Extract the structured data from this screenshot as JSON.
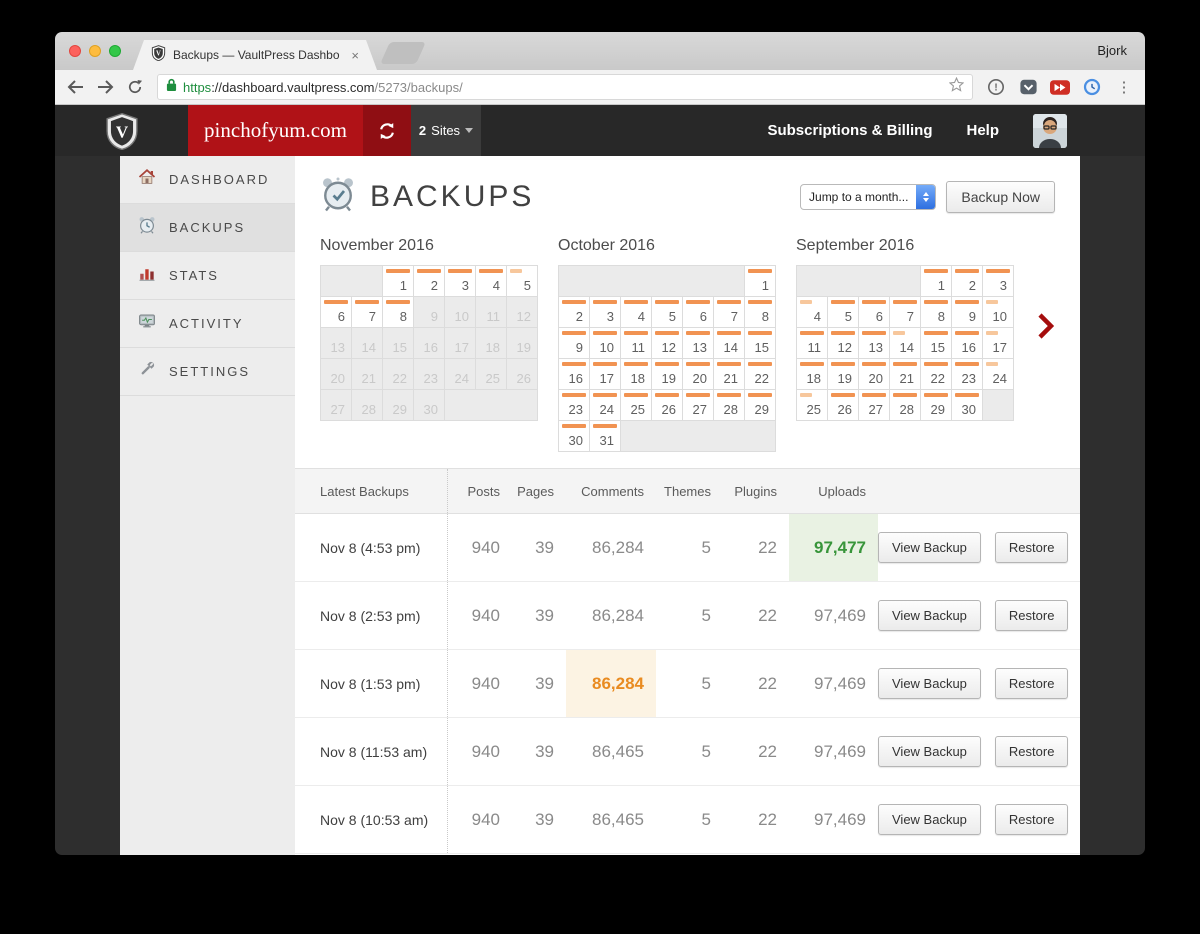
{
  "browser": {
    "tab_title": "Backups — VaultPress Dashbo",
    "profile": "Bjork",
    "url": {
      "scheme": "https",
      "host": "://dashboard.vaultpress.com",
      "path": "/5273/backups/"
    },
    "glyphs": {
      "tab_close": "×",
      "overflow_menu": "⋮"
    }
  },
  "nav": {
    "site_button": "pinchofyum.com",
    "sites_count": "2",
    "sites_label": "Sites",
    "billing_link": "Subscriptions & Billing",
    "help_link": "Help"
  },
  "sidebar": {
    "items": [
      {
        "label": "DASHBOARD",
        "icon": "house-icon",
        "active": false
      },
      {
        "label": "BACKUPS",
        "icon": "alarm-clock-icon",
        "active": true
      },
      {
        "label": "STATS",
        "icon": "bar-chart-icon",
        "active": false
      },
      {
        "label": "ACTIVITY",
        "icon": "activity-monitor-icon",
        "active": false
      },
      {
        "label": "SETTINGS",
        "icon": "wrench-icon",
        "active": false
      }
    ]
  },
  "main": {
    "title": "BACKUPS",
    "month_select": "Jump to a month...",
    "backup_now_button": "Backup Now"
  },
  "calendars": [
    {
      "title": "November 2016",
      "weeks": [
        [
          {
            "span": 2
          },
          {
            "d": 1,
            "bar": "normal"
          },
          {
            "d": 2,
            "bar": "normal"
          },
          {
            "d": 3,
            "bar": "normal"
          },
          {
            "d": 4,
            "bar": "normal"
          },
          {
            "d": 5,
            "bar": "light"
          }
        ],
        [
          {
            "d": 6,
            "bar": "normal"
          },
          {
            "d": 7,
            "bar": "normal"
          },
          {
            "d": 8,
            "bar": "normal"
          },
          {
            "d": 9,
            "off": true
          },
          {
            "d": 10,
            "off": true
          },
          {
            "d": 11,
            "off": true
          },
          {
            "d": 12,
            "off": true
          }
        ],
        [
          {
            "d": 13,
            "off": true
          },
          {
            "d": 14,
            "off": true
          },
          {
            "d": 15,
            "off": true
          },
          {
            "d": 16,
            "off": true
          },
          {
            "d": 17,
            "off": true
          },
          {
            "d": 18,
            "off": true
          },
          {
            "d": 19,
            "off": true
          }
        ],
        [
          {
            "d": 20,
            "off": true
          },
          {
            "d": 21,
            "off": true
          },
          {
            "d": 22,
            "off": true
          },
          {
            "d": 23,
            "off": true
          },
          {
            "d": 24,
            "off": true
          },
          {
            "d": 25,
            "off": true
          },
          {
            "d": 26,
            "off": true
          }
        ],
        [
          {
            "d": 27,
            "off": true
          },
          {
            "d": 28,
            "off": true
          },
          {
            "d": 29,
            "off": true
          },
          {
            "d": 30,
            "off": true
          },
          {
            "span": 3
          }
        ]
      ]
    },
    {
      "title": "October 2016",
      "weeks": [
        [
          {
            "span": 6
          },
          {
            "d": 1,
            "bar": "normal"
          }
        ],
        [
          {
            "d": 2,
            "bar": "normal"
          },
          {
            "d": 3,
            "bar": "normal"
          },
          {
            "d": 4,
            "bar": "normal"
          },
          {
            "d": 5,
            "bar": "normal"
          },
          {
            "d": 6,
            "bar": "normal"
          },
          {
            "d": 7,
            "bar": "normal"
          },
          {
            "d": 8,
            "bar": "normal"
          }
        ],
        [
          {
            "d": 9,
            "bar": "normal"
          },
          {
            "d": 10,
            "bar": "normal"
          },
          {
            "d": 11,
            "bar": "normal"
          },
          {
            "d": 12,
            "bar": "normal"
          },
          {
            "d": 13,
            "bar": "normal"
          },
          {
            "d": 14,
            "bar": "normal"
          },
          {
            "d": 15,
            "bar": "normal"
          }
        ],
        [
          {
            "d": 16,
            "bar": "normal"
          },
          {
            "d": 17,
            "bar": "normal"
          },
          {
            "d": 18,
            "bar": "normal"
          },
          {
            "d": 19,
            "bar": "normal"
          },
          {
            "d": 20,
            "bar": "normal"
          },
          {
            "d": 21,
            "bar": "normal"
          },
          {
            "d": 22,
            "bar": "normal"
          }
        ],
        [
          {
            "d": 23,
            "bar": "normal"
          },
          {
            "d": 24,
            "bar": "normal"
          },
          {
            "d": 25,
            "bar": "normal"
          },
          {
            "d": 26,
            "bar": "normal"
          },
          {
            "d": 27,
            "bar": "normal"
          },
          {
            "d": 28,
            "bar": "normal"
          },
          {
            "d": 29,
            "bar": "normal"
          }
        ],
        [
          {
            "d": 30,
            "bar": "normal"
          },
          {
            "d": 31,
            "bar": "normal"
          },
          {
            "span": 5
          }
        ]
      ]
    },
    {
      "title": "September 2016",
      "weeks": [
        [
          {
            "span": 4
          },
          {
            "d": 1,
            "bar": "normal"
          },
          {
            "d": 2,
            "bar": "normal"
          },
          {
            "d": 3,
            "bar": "normal"
          }
        ],
        [
          {
            "d": 4,
            "bar": "light"
          },
          {
            "d": 5,
            "bar": "normal"
          },
          {
            "d": 6,
            "bar": "normal"
          },
          {
            "d": 7,
            "bar": "normal"
          },
          {
            "d": 8,
            "bar": "normal"
          },
          {
            "d": 9,
            "bar": "normal"
          },
          {
            "d": 10,
            "bar": "light"
          }
        ],
        [
          {
            "d": 11,
            "bar": "normal"
          },
          {
            "d": 12,
            "bar": "normal"
          },
          {
            "d": 13,
            "bar": "normal"
          },
          {
            "d": 14,
            "bar": "light"
          },
          {
            "d": 15,
            "bar": "normal"
          },
          {
            "d": 16,
            "bar": "normal"
          },
          {
            "d": 17,
            "bar": "light"
          }
        ],
        [
          {
            "d": 18,
            "bar": "normal"
          },
          {
            "d": 19,
            "bar": "normal"
          },
          {
            "d": 20,
            "bar": "normal"
          },
          {
            "d": 21,
            "bar": "normal"
          },
          {
            "d": 22,
            "bar": "normal"
          },
          {
            "d": 23,
            "bar": "normal"
          },
          {
            "d": 24,
            "bar": "light"
          }
        ],
        [
          {
            "d": 25,
            "bar": "light"
          },
          {
            "d": 26,
            "bar": "normal"
          },
          {
            "d": 27,
            "bar": "normal"
          },
          {
            "d": 28,
            "bar": "normal"
          },
          {
            "d": 29,
            "bar": "normal"
          },
          {
            "d": 30,
            "bar": "normal"
          },
          {
            "span": 1
          }
        ]
      ]
    }
  ],
  "table": {
    "title": "Latest Backups",
    "columns": [
      "Posts",
      "Pages",
      "Comments",
      "Themes",
      "Plugins",
      "Uploads"
    ],
    "view_button": "View Backup",
    "restore_button": "Restore",
    "rows": [
      {
        "date": "Nov 8 (4:53 pm)",
        "values": [
          "940",
          "39",
          "86,284",
          "5",
          "22",
          "97,477"
        ],
        "highlight_col": 5,
        "highlight": "green"
      },
      {
        "date": "Nov 8 (2:53 pm)",
        "values": [
          "940",
          "39",
          "86,284",
          "5",
          "22",
          "97,469"
        ]
      },
      {
        "date": "Nov 8 (1:53 pm)",
        "values": [
          "940",
          "39",
          "86,284",
          "5",
          "22",
          "97,469"
        ],
        "highlight_col": 2,
        "highlight": "orange"
      },
      {
        "date": "Nov 8 (11:53 am)",
        "values": [
          "940",
          "39",
          "86,465",
          "5",
          "22",
          "97,469"
        ]
      },
      {
        "date": "Nov 8 (10:53 am)",
        "values": [
          "940",
          "39",
          "86,465",
          "5",
          "22",
          "97,469"
        ]
      }
    ]
  },
  "colors": {
    "accent_red": "#b01217",
    "calendar_bar_orange": "#f19352",
    "calendar_bar_orange_light": "#f7c79c",
    "highlight_green_bg": "#e9f2e3",
    "highlight_green_text": "#38953a",
    "highlight_orange_bg": "#fcf3e3",
    "highlight_orange_text": "#e98b21"
  }
}
